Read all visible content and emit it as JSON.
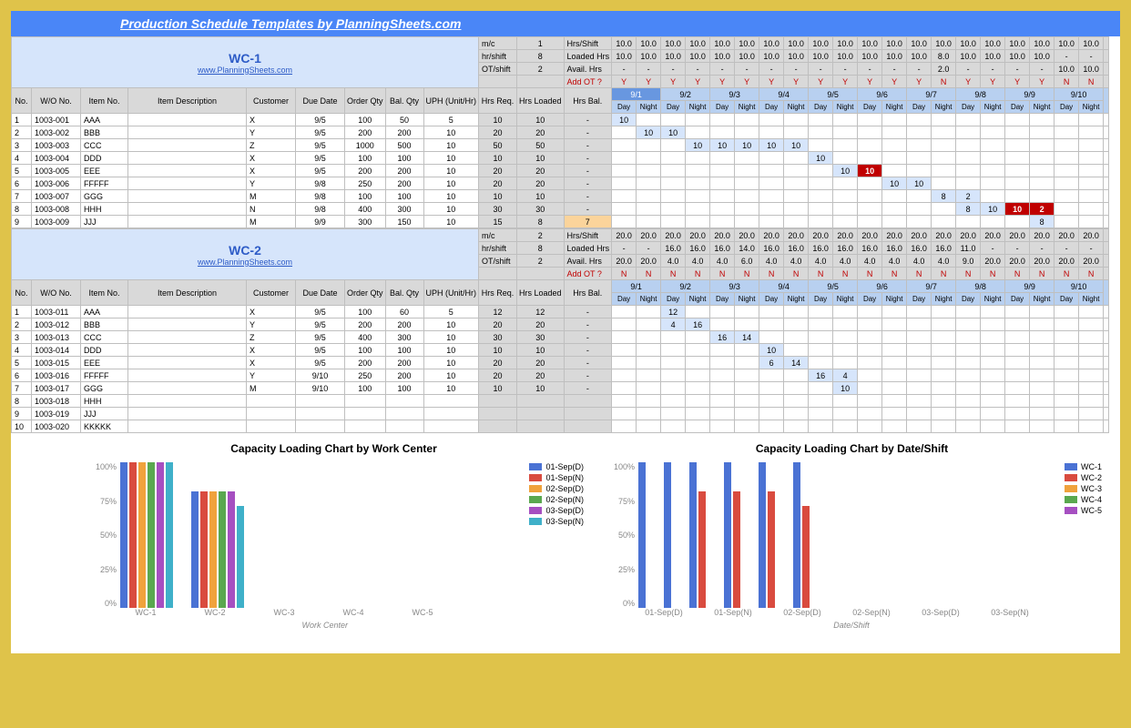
{
  "title": "Production Schedule Templates by PlanningSheets.com",
  "link": "www.PlanningSheets.com",
  "wc_labels": [
    "WC-1",
    "WC-2"
  ],
  "params": {
    "mc": "m/c",
    "hrshift": "hr/shift",
    "otshift": "OT/shift"
  },
  "wc": [
    {
      "name": "WC-1",
      "mc": 1,
      "hrshift": 8,
      "otshift": 2
    },
    {
      "name": "WC-2",
      "mc": 2,
      "hrshift": 8,
      "otshift": 2
    }
  ],
  "right_hdrs": [
    "Hrs/Shift",
    "Loaded Hrs",
    "Avail. Hrs",
    "Add OT ?"
  ],
  "col_hdrs": [
    "No.",
    "W/O No.",
    "Item No.",
    "Item Description",
    "Customer",
    "Due Date",
    "Order Qty",
    "Bal. Qty",
    "UPH (Unit/Hr)",
    "Hrs Req.",
    "Hrs Loaded",
    "Hrs Bal."
  ],
  "dates": [
    "9/1",
    "9/2",
    "9/3",
    "9/4",
    "9/5",
    "9/6",
    "9/7",
    "9/8",
    "9/9",
    "9/10"
  ],
  "daynight": [
    "Day",
    "Night"
  ],
  "wc1": {
    "stats": {
      "hrs_shift": [
        "10.0",
        "10.0",
        "10.0",
        "10.0",
        "10.0",
        "10.0",
        "10.0",
        "10.0",
        "10.0",
        "10.0",
        "10.0",
        "10.0",
        "10.0",
        "10.0",
        "10.0",
        "10.0",
        "10.0",
        "10.0",
        "10.0",
        "10.0"
      ],
      "loaded_hrs": [
        "10.0",
        "10.0",
        "10.0",
        "10.0",
        "10.0",
        "10.0",
        "10.0",
        "10.0",
        "10.0",
        "10.0",
        "10.0",
        "10.0",
        "10.0",
        "8.0",
        "10.0",
        "10.0",
        "10.0",
        "10.0",
        "-",
        "-"
      ],
      "avail_hrs": [
        "-",
        "-",
        "-",
        "-",
        "-",
        "-",
        "-",
        "-",
        "-",
        "-",
        "-",
        "-",
        "-",
        "2.0",
        "-",
        "-",
        "-",
        "-",
        "10.0",
        "10.0"
      ],
      "add_ot": [
        "Y",
        "Y",
        "Y",
        "Y",
        "Y",
        "Y",
        "Y",
        "Y",
        "Y",
        "Y",
        "Y",
        "Y",
        "Y",
        "N",
        "Y",
        "Y",
        "Y",
        "Y",
        "N",
        "N"
      ]
    },
    "rows": [
      {
        "no": 1,
        "wo": "1003-001",
        "item": "AAA",
        "desc": "",
        "cust": "X",
        "due": "9/5",
        "oq": 100,
        "bq": 50,
        "uph": 5,
        "req": 10,
        "load": 10,
        "bal": "-",
        "sched": {
          "0": "10"
        }
      },
      {
        "no": 2,
        "wo": "1003-002",
        "item": "BBB",
        "desc": "",
        "cust": "Y",
        "due": "9/5",
        "oq": 200,
        "bq": 200,
        "uph": 10,
        "req": 20,
        "load": 20,
        "bal": "-",
        "sched": {
          "1": "10",
          "2": "10"
        }
      },
      {
        "no": 3,
        "wo": "1003-003",
        "item": "CCC",
        "desc": "",
        "cust": "Z",
        "due": "9/5",
        "oq": 1000,
        "bq": 500,
        "uph": 10,
        "req": 50,
        "load": 50,
        "bal": "-",
        "sched": {
          "3": "10",
          "4": "10",
          "5": "10",
          "6": "10",
          "7": "10"
        }
      },
      {
        "no": 4,
        "wo": "1003-004",
        "item": "DDD",
        "desc": "",
        "cust": "X",
        "due": "9/5",
        "oq": 100,
        "bq": 100,
        "uph": 10,
        "req": 10,
        "load": 10,
        "bal": "-",
        "sched": {
          "8": "10"
        }
      },
      {
        "no": 5,
        "wo": "1003-005",
        "item": "EEE",
        "desc": "",
        "cust": "X",
        "due": "9/5",
        "oq": 200,
        "bq": 200,
        "uph": 10,
        "req": 20,
        "load": 20,
        "bal": "-",
        "sched": {
          "9": "10"
        },
        "red": {
          "10": "10"
        }
      },
      {
        "no": 6,
        "wo": "1003-006",
        "item": "FFFFF",
        "desc": "",
        "cust": "Y",
        "due": "9/8",
        "oq": 250,
        "bq": 200,
        "uph": 10,
        "req": 20,
        "load": 20,
        "bal": "-",
        "sched": {
          "11": "10",
          "12": "10"
        }
      },
      {
        "no": 7,
        "wo": "1003-007",
        "item": "GGG",
        "desc": "",
        "cust": "M",
        "due": "9/8",
        "oq": 100,
        "bq": 100,
        "uph": 10,
        "req": 10,
        "load": 10,
        "bal": "-",
        "sched": {
          "13": "8",
          "14": "2"
        }
      },
      {
        "no": 8,
        "wo": "1003-008",
        "item": "HHH",
        "desc": "",
        "cust": "N",
        "due": "9/8",
        "oq": 400,
        "bq": 300,
        "uph": 10,
        "req": 30,
        "load": 30,
        "bal": "-",
        "sched": {
          "14": "8",
          "15": "10"
        },
        "red": {
          "16": "10",
          "17": "2"
        }
      },
      {
        "no": 9,
        "wo": "1003-009",
        "item": "JJJ",
        "desc": "",
        "cust": "M",
        "due": "9/9",
        "oq": 300,
        "bq": 150,
        "uph": 10,
        "req": 15,
        "load": 8,
        "bal": "7",
        "balorange": true,
        "sched": {
          "17": "8"
        }
      }
    ]
  },
  "wc2": {
    "stats": {
      "hrs_shift": [
        "20.0",
        "20.0",
        "20.0",
        "20.0",
        "20.0",
        "20.0",
        "20.0",
        "20.0",
        "20.0",
        "20.0",
        "20.0",
        "20.0",
        "20.0",
        "20.0",
        "20.0",
        "20.0",
        "20.0",
        "20.0",
        "20.0",
        "20.0"
      ],
      "loaded_hrs": [
        "-",
        "-",
        "16.0",
        "16.0",
        "16.0",
        "14.0",
        "16.0",
        "16.0",
        "16.0",
        "16.0",
        "16.0",
        "16.0",
        "16.0",
        "16.0",
        "11.0",
        "-",
        "-",
        "-",
        "-",
        "-"
      ],
      "avail_hrs": [
        "20.0",
        "20.0",
        "4.0",
        "4.0",
        "4.0",
        "6.0",
        "4.0",
        "4.0",
        "4.0",
        "4.0",
        "4.0",
        "4.0",
        "4.0",
        "4.0",
        "9.0",
        "20.0",
        "20.0",
        "20.0",
        "20.0",
        "20.0"
      ],
      "add_ot": [
        "N",
        "N",
        "N",
        "N",
        "N",
        "N",
        "N",
        "N",
        "N",
        "N",
        "N",
        "N",
        "N",
        "N",
        "N",
        "N",
        "N",
        "N",
        "N",
        "N"
      ]
    },
    "rows": [
      {
        "no": 1,
        "wo": "1003-011",
        "item": "AAA",
        "desc": "",
        "cust": "X",
        "due": "9/5",
        "oq": 100,
        "bq": 60,
        "uph": 5,
        "req": 12,
        "load": 12,
        "bal": "-",
        "sched": {
          "2": "12"
        }
      },
      {
        "no": 2,
        "wo": "1003-012",
        "item": "BBB",
        "desc": "",
        "cust": "Y",
        "due": "9/5",
        "oq": 200,
        "bq": 200,
        "uph": 10,
        "req": 20,
        "load": 20,
        "bal": "-",
        "sched": {
          "2": "4",
          "3": "16"
        }
      },
      {
        "no": 3,
        "wo": "1003-013",
        "item": "CCC",
        "desc": "",
        "cust": "Z",
        "due": "9/5",
        "oq": 400,
        "bq": 300,
        "uph": 10,
        "req": 30,
        "load": 30,
        "bal": "-",
        "sched": {
          "4": "16",
          "5": "14"
        }
      },
      {
        "no": 4,
        "wo": "1003-014",
        "item": "DDD",
        "desc": "",
        "cust": "X",
        "due": "9/5",
        "oq": 100,
        "bq": 100,
        "uph": 10,
        "req": 10,
        "load": 10,
        "bal": "-",
        "sched": {
          "6": "10"
        }
      },
      {
        "no": 5,
        "wo": "1003-015",
        "item": "EEE",
        "desc": "",
        "cust": "X",
        "due": "9/5",
        "oq": 200,
        "bq": 200,
        "uph": 10,
        "req": 20,
        "load": 20,
        "bal": "-",
        "sched": {
          "6": "6",
          "7": "14"
        }
      },
      {
        "no": 6,
        "wo": "1003-016",
        "item": "FFFFF",
        "desc": "",
        "cust": "Y",
        "due": "9/10",
        "oq": 250,
        "bq": 200,
        "uph": 10,
        "req": 20,
        "load": 20,
        "bal": "-",
        "sched": {
          "8": "16",
          "9": "4"
        }
      },
      {
        "no": 7,
        "wo": "1003-017",
        "item": "GGG",
        "desc": "",
        "cust": "M",
        "due": "9/10",
        "oq": 100,
        "bq": 100,
        "uph": 10,
        "req": 10,
        "load": 10,
        "bal": "-",
        "sched": {
          "9": "10"
        }
      },
      {
        "no": 8,
        "wo": "1003-018",
        "item": "HHH",
        "desc": "",
        "cust": "",
        "due": "",
        "oq": "",
        "bq": "",
        "uph": "",
        "req": "",
        "load": "",
        "bal": "",
        "sched": {}
      },
      {
        "no": 9,
        "wo": "1003-019",
        "item": "JJJ",
        "desc": "",
        "cust": "",
        "due": "",
        "oq": "",
        "bq": "",
        "uph": "",
        "req": "",
        "load": "",
        "bal": "",
        "sched": {}
      },
      {
        "no": 10,
        "wo": "1003-020",
        "item": "KKKKK",
        "desc": "",
        "cust": "",
        "due": "",
        "oq": "",
        "bq": "",
        "uph": "",
        "req": "",
        "load": "",
        "bal": "",
        "sched": {}
      }
    ]
  },
  "chart_data": [
    {
      "type": "bar",
      "title": "Capacity Loading Chart by Work Center",
      "xlabel": "Work Center",
      "categories": [
        "WC-1",
        "WC-2",
        "WC-3",
        "WC-4",
        "WC-5"
      ],
      "ylim": [
        0,
        100
      ],
      "yticks": [
        "100%",
        "75%",
        "50%",
        "25%",
        "0%"
      ],
      "series": [
        {
          "name": "01-Sep(D)",
          "color": "#4a72d4",
          "values": [
            100,
            80,
            0,
            0,
            0
          ]
        },
        {
          "name": "01-Sep(N)",
          "color": "#d94b3f",
          "values": [
            100,
            80,
            0,
            0,
            0
          ]
        },
        {
          "name": "02-Sep(D)",
          "color": "#f0a23c",
          "values": [
            100,
            80,
            0,
            0,
            0
          ]
        },
        {
          "name": "02-Sep(N)",
          "color": "#5aa84f",
          "values": [
            100,
            80,
            0,
            0,
            0
          ]
        },
        {
          "name": "03-Sep(D)",
          "color": "#a64fc1",
          "values": [
            100,
            80,
            0,
            0,
            0
          ]
        },
        {
          "name": "03-Sep(N)",
          "color": "#3fb0c9",
          "values": [
            100,
            70,
            0,
            0,
            0
          ]
        }
      ]
    },
    {
      "type": "bar",
      "title": "Capacity Loading Chart by Date/Shift",
      "xlabel": "Date/Shift",
      "categories": [
        "01-Sep(D)",
        "01-Sep(N)",
        "02-Sep(D)",
        "02-Sep(N)",
        "03-Sep(D)",
        "03-Sep(N)"
      ],
      "ylim": [
        0,
        100
      ],
      "yticks": [
        "100%",
        "75%",
        "50%",
        "25%",
        "0%"
      ],
      "series": [
        {
          "name": "WC-1",
          "color": "#4a72d4",
          "values": [
            100,
            100,
            100,
            100,
            100,
            100
          ]
        },
        {
          "name": "WC-2",
          "color": "#d94b3f",
          "values": [
            0,
            0,
            80,
            80,
            80,
            70
          ]
        },
        {
          "name": "WC-3",
          "color": "#f0a23c",
          "values": [
            0,
            0,
            0,
            0,
            0,
            0
          ]
        },
        {
          "name": "WC-4",
          "color": "#5aa84f",
          "values": [
            0,
            0,
            0,
            0,
            0,
            0
          ]
        },
        {
          "name": "WC-5",
          "color": "#a64fc1",
          "values": [
            0,
            0,
            0,
            0,
            0,
            0
          ]
        }
      ]
    }
  ]
}
